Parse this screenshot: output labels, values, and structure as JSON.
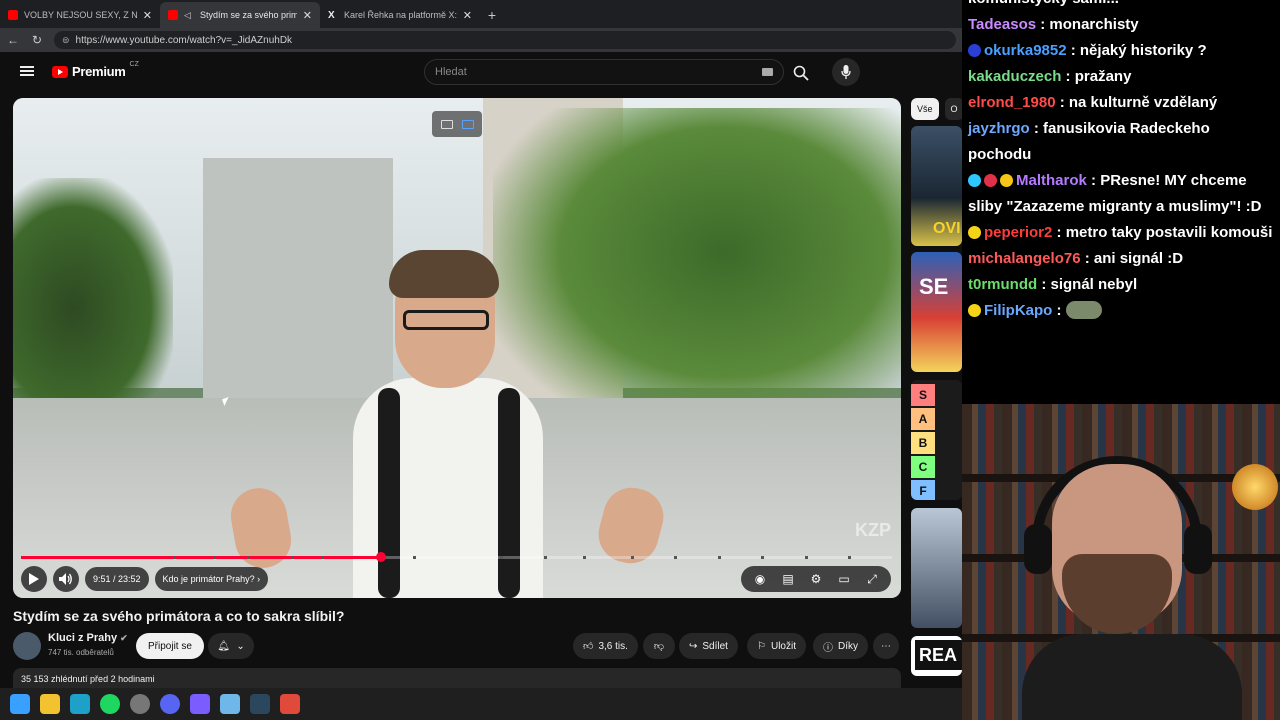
{
  "browser": {
    "tabs": [
      {
        "title": "VOLBY NEJSOU SEXY, Z NICH NE",
        "favicon": "youtube-icon",
        "active": false
      },
      {
        "title": "Stydím se za svého primátora",
        "favicon": "youtube-icon",
        "active": true
      },
      {
        "title": "Karel Řehka na platformě X: „Po vl",
        "favicon": "x-icon",
        "active": false
      }
    ],
    "url": "https://www.youtube.com/watch?v=_JidAZnuhDk"
  },
  "youtube": {
    "logo_text": "Premium",
    "country": "CZ",
    "search_placeholder": "Hledat",
    "player": {
      "time": "9:51 / 23:52",
      "chapter": "Kdo je primátor Prahy?",
      "progress_fraction": 0.413,
      "watermark": "KZP"
    },
    "video_title": "Stydím se za svého primátora a co to sakra slíbil?",
    "channel": {
      "name": "Kluci z Prahy",
      "subscribers": "747 tis. odběratelů",
      "join_label": "Připojit se"
    },
    "actions": {
      "likes": "3,6 tis.",
      "share": "Sdílet",
      "save": "Uložit",
      "thanks": "Díky"
    },
    "description_meta": "35 153 zhlédnutí  před 2 hodinami",
    "chips": [
      "Vše",
      "O"
    ],
    "tier_letters": [
      "S",
      "A",
      "B",
      "C",
      "F"
    ],
    "tier_colors": [
      "#ff7f7f",
      "#ffbf7f",
      "#ffdf7f",
      "#7fff7f",
      "#7fbfff"
    ],
    "thumb_text": {
      "t1": "OVI",
      "t2": "SE",
      "t5": "REA"
    }
  },
  "chat": {
    "partial_top": "komunistycký sami...",
    "messages": [
      {
        "user": "Tadeasos",
        "color": "#c98bff",
        "text": ": monarchisty",
        "badges": []
      },
      {
        "user": "okurka9852",
        "color": "#4aa0ff",
        "text": ": nějaký historiky ?",
        "badges": [
          "#2a3fd6"
        ]
      },
      {
        "user": "kakaduczech",
        "color": "#7bdc8a",
        "text": ": pražany",
        "badges": []
      },
      {
        "user": "elrond_1980",
        "color": "#ff4b4b",
        "text": ": na kulturně vzdělaný",
        "badges": []
      },
      {
        "user": "jayzhrgo",
        "color": "#6fa8ff",
        "text": ": fanusikovia Radeckeho pochodu",
        "badges": []
      },
      {
        "user": "Maltharok",
        "color": "#b57bff",
        "text": ": PResne! MY chceme sliby \"Zazazeme migranty a muslimy\"! :D",
        "badges": [
          "#2ec7ff",
          "#e0314a",
          "#f5c518"
        ]
      },
      {
        "user": "peperior2",
        "color": "#ff3c3c",
        "text": ": metro taky postavili komouši",
        "badges": [
          "#f5d418"
        ]
      },
      {
        "user": "michalangelo76",
        "color": "#ff5a5a",
        "text": ": ani signál :D",
        "badges": []
      },
      {
        "user": "t0rmundd",
        "color": "#6cdc6c",
        "text": ": signál nebyl",
        "badges": []
      },
      {
        "user": "FilipKapo",
        "color": "#6aa8ff",
        "text": ":",
        "badges": [
          "#f5d418"
        ],
        "emote": true
      }
    ]
  },
  "taskbar": [
    "windows-start-icon",
    "file-explorer-icon",
    "edge-icon",
    "spotify-icon",
    "clock-app-icon",
    "discord-icon",
    "copilot-icon",
    "notepad-icon",
    "steam-icon",
    "maps-icon"
  ]
}
